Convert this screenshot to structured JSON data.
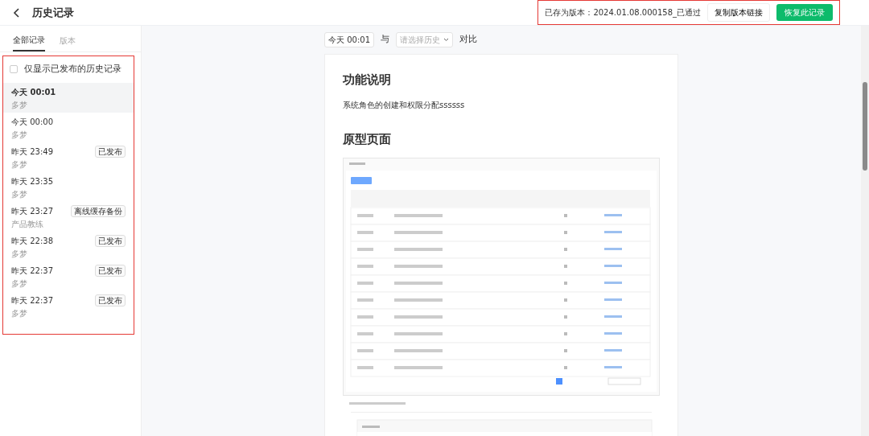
{
  "header": {
    "title": "历史记录",
    "version_text": "已存为版本：2024.01.08.000158_已通过",
    "copy_button": "复制版本链接",
    "restore_button": "恢复此记录"
  },
  "tabs": [
    {
      "label": "全部记录",
      "selected": true
    },
    {
      "label": "版本",
      "selected": false
    }
  ],
  "filter": {
    "label": "仅显示已发布的历史记录",
    "checked": false
  },
  "records": [
    {
      "time": "今天 00:01",
      "author": "多梦",
      "selected": true
    },
    {
      "time": "今天 00:00",
      "author": "多梦",
      "selected": false
    },
    {
      "time": "昨天 23:49",
      "author": "多梦",
      "tag": "已发布",
      "selected": false
    },
    {
      "time": "昨天 23:35",
      "author": "多梦",
      "selected": false
    },
    {
      "time": "昨天 23:27",
      "author": "产品教练",
      "tag": "离线缓存备份",
      "selected": false
    },
    {
      "time": "昨天 22:38",
      "author": "多梦",
      "tag": "已发布",
      "selected": false
    },
    {
      "time": "昨天 22:37",
      "author": "多梦",
      "tag": "已发布",
      "selected": false
    },
    {
      "time": "昨天 22:37",
      "author": "多梦",
      "tag": "已发布",
      "selected": false
    }
  ],
  "compare": {
    "current": "今天 00:01",
    "joiner": "与",
    "select_placeholder": "请选择历史",
    "action": "对比"
  },
  "document": {
    "sections": [
      {
        "heading": "功能说明",
        "text": "系统角色的创建和权限分配ssssss"
      },
      {
        "heading": "原型页面"
      }
    ]
  }
}
